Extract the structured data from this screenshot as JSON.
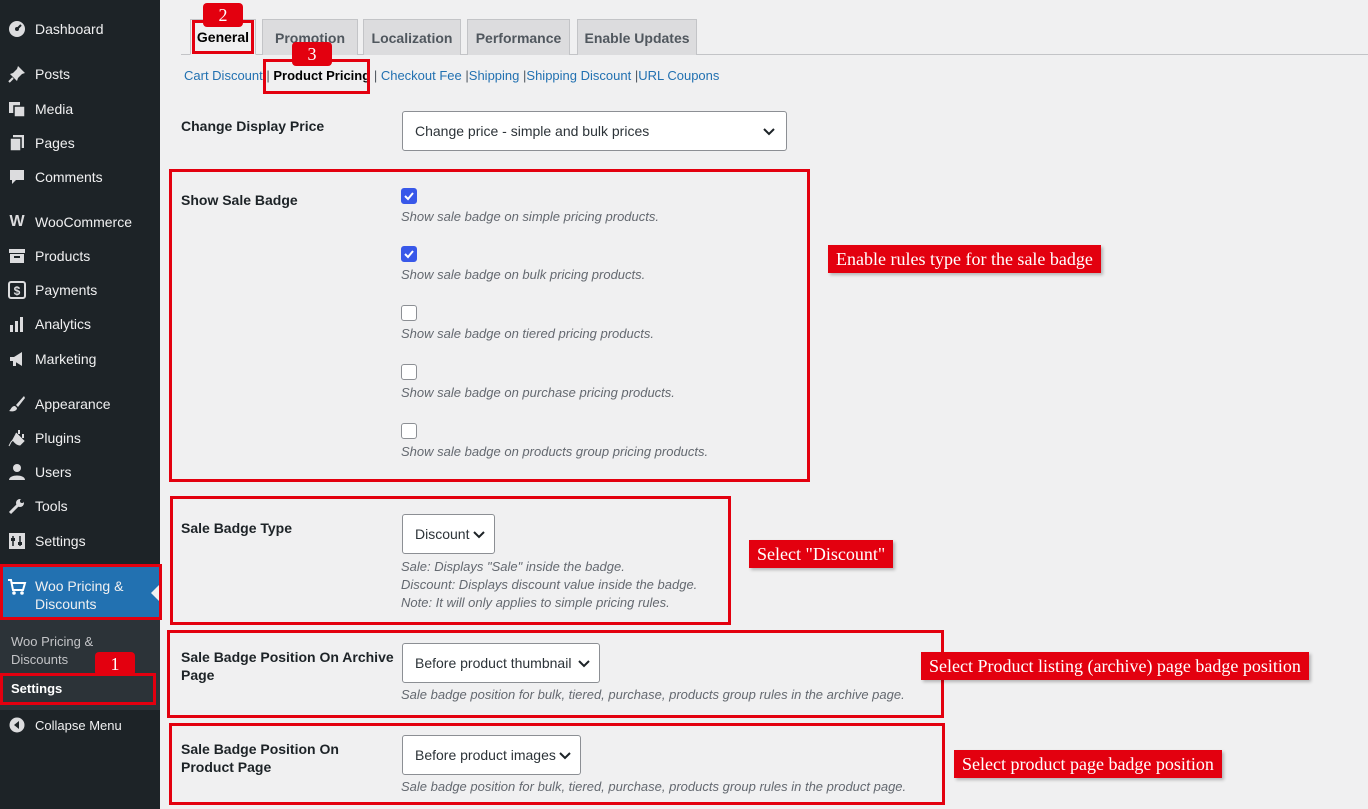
{
  "sidebar": {
    "items": [
      {
        "label": "Dashboard",
        "icon": "dashboard-icon"
      },
      {
        "label": "Posts",
        "icon": "pin-icon"
      },
      {
        "label": "Media",
        "icon": "media-icon"
      },
      {
        "label": "Pages",
        "icon": "pages-icon"
      },
      {
        "label": "Comments",
        "icon": "comment-icon"
      },
      {
        "label": "WooCommerce",
        "icon": "woocommerce-icon"
      },
      {
        "label": "Products",
        "icon": "archive-icon"
      },
      {
        "label": "Payments",
        "icon": "payments-icon"
      },
      {
        "label": "Analytics",
        "icon": "bar-chart-icon"
      },
      {
        "label": "Marketing",
        "icon": "megaphone-icon"
      },
      {
        "label": "Appearance",
        "icon": "brush-icon"
      },
      {
        "label": "Plugins",
        "icon": "plug-icon"
      },
      {
        "label": "Users",
        "icon": "user-icon"
      },
      {
        "label": "Tools",
        "icon": "wrench-icon"
      },
      {
        "label": "Settings",
        "icon": "settings-icon"
      }
    ],
    "active": {
      "label_line1": "Woo Pricing &",
      "label_line2": "Discounts",
      "icon": "cart-icon"
    },
    "submenu": {
      "item1_line1": "Woo Pricing &",
      "item1_line2": "Discounts",
      "item2": "Settings"
    },
    "collapse": "Collapse Menu"
  },
  "tabs": [
    "General",
    "Promotion",
    "Localization",
    "Performance",
    "Enable Updates"
  ],
  "subtabs": {
    "cart_discount": "Cart Discount",
    "product_pricing": "Product Pricing",
    "checkout_fee": "Checkout Fee",
    "shipping": "Shipping",
    "shipping_discount": "Shipping Discount",
    "url_coupons": "URL Coupons"
  },
  "form": {
    "display_price": {
      "label": "Change Display Price",
      "value": "Change price - simple and bulk prices"
    },
    "sale_badge": {
      "label": "Show Sale Badge",
      "options": [
        {
          "checked": true,
          "desc": "Show sale badge on simple pricing products."
        },
        {
          "checked": true,
          "desc": "Show sale badge on bulk pricing products."
        },
        {
          "checked": false,
          "desc": "Show sale badge on tiered pricing products."
        },
        {
          "checked": false,
          "desc": "Show sale badge on purchase pricing products."
        },
        {
          "checked": false,
          "desc": "Show sale badge on products group pricing products."
        }
      ]
    },
    "badge_type": {
      "label": "Sale Badge Type",
      "value": "Discount",
      "desc1": "Sale: Displays \"Sale\" inside the badge.",
      "desc2": "Discount: Displays discount value inside the badge.",
      "desc3": "Note: It will only applies to simple pricing rules."
    },
    "archive_pos": {
      "label_line1": "Sale Badge Position On Archive",
      "label_line2": "Page",
      "value": "Before product thumbnail",
      "desc": "Sale badge position for bulk, tiered, purchase, products group rules in the archive page."
    },
    "product_pos": {
      "label_line1": "Sale Badge Position On",
      "label_line2": "Product Page",
      "value": "Before product images",
      "desc": "Sale badge position for bulk, tiered, purchase, products group rules in the product page."
    }
  },
  "annotations": {
    "steps": [
      "1",
      "2",
      "3"
    ],
    "callouts": {
      "badge_rules": "Enable rules type for the sale badge",
      "discount": "Select \"Discount\"",
      "archive": "Select Product listing (archive) page badge position",
      "product": "Select product page badge position"
    },
    "color": "#e3000f"
  },
  "colors": {
    "sidebar_bg": "#1d2327",
    "active_menu": "#2271b1",
    "checkbox_checked": "#3858e9",
    "link": "#2271b1"
  }
}
